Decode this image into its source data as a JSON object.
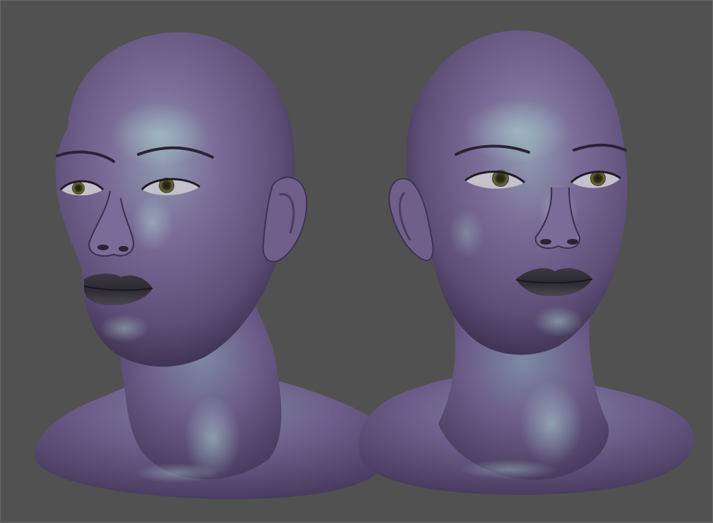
{
  "scene": {
    "background_color": "#515151",
    "viewport_border_color": "#6a6a6a",
    "material": {
      "base": "#6f5f8a",
      "highlight": "#a9d8d2",
      "shadow": "#2a2236",
      "lips": "#36323a",
      "iris": "#6b6a3a"
    },
    "models": [
      {
        "name": "female-head-bust-three-quarter-view",
        "view": "three-quarter"
      },
      {
        "name": "female-head-bust-front-view",
        "view": "front"
      }
    ]
  }
}
